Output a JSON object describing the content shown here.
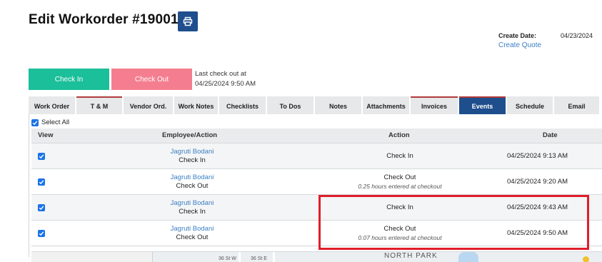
{
  "header": {
    "title": "Edit Workorder #190010",
    "create_date_label": "Create Date:",
    "create_date_value": "04/23/2024",
    "create_quote_label": "Create Quote"
  },
  "actions": {
    "check_in_label": "Check In",
    "check_out_label": "Check Out",
    "last_checkout_line1": "Last check out at",
    "last_checkout_line2": "04/25/2024 9:50 AM"
  },
  "tabs": [
    {
      "label": "Work Order"
    },
    {
      "label": "T & M"
    },
    {
      "label": "Vendor Ord."
    },
    {
      "label": "Work Notes"
    },
    {
      "label": "Checklists"
    },
    {
      "label": "To Dos"
    },
    {
      "label": "Notes"
    },
    {
      "label": "Attachments"
    },
    {
      "label": "Invoices"
    },
    {
      "label": "Events"
    },
    {
      "label": "Schedule"
    },
    {
      "label": "Email"
    }
  ],
  "active_tab": "Events",
  "events": {
    "select_all_label": "Select All",
    "columns": {
      "view": "View",
      "employee": "Employee/Action",
      "action": "Action",
      "date": "Date"
    },
    "rows": [
      {
        "employee": "Jagruti Bodani",
        "employee_action": "Check In",
        "action": "Check In",
        "note": "",
        "date": "04/25/2024 9:13 AM"
      },
      {
        "employee": "Jagruti Bodani",
        "employee_action": "Check Out",
        "action": "Check Out",
        "note": "0.25 hours entered at checkout",
        "date": "04/25/2024 9:20 AM"
      },
      {
        "employee": "Jagruti Bodani",
        "employee_action": "Check In",
        "action": "Check In",
        "note": "",
        "date": "04/25/2024 9:43 AM"
      },
      {
        "employee": "Jagruti Bodani",
        "employee_action": "Check Out",
        "action": "Check Out",
        "note": "0.07 hours entered at checkout",
        "date": "04/25/2024 9:50 AM"
      }
    ]
  },
  "map": {
    "street_1": "36 St W",
    "street_2": "36 St E",
    "area": "NORTH PARK"
  },
  "colors": {
    "check_in": "#1bbf9a",
    "check_out": "#f47e8f",
    "active_tab": "#1f4e8c",
    "link": "#3b7fc4",
    "highlight": "#e01e2a"
  }
}
